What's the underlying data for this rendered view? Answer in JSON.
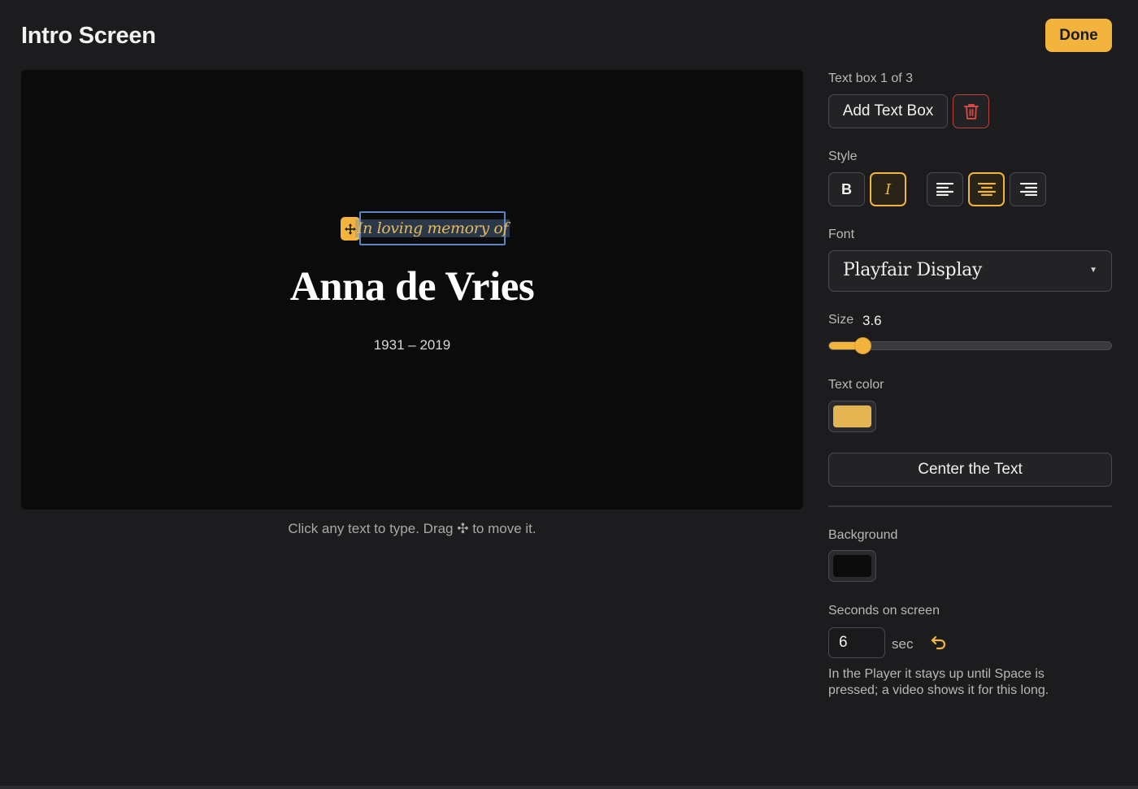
{
  "header": {
    "title": "Intro Screen",
    "done_label": "Done"
  },
  "stage": {
    "subtitle": "In loving memory of",
    "name": "Anna de Vries",
    "dates": "1931 – 2019",
    "hint": "Click any text to type. Drag ✣ to move it."
  },
  "panel": {
    "textbox_counter": "Text box 1 of 3",
    "add_textbox_label": "Add Text Box",
    "style_label": "Style",
    "bold_label": "B",
    "italic_label": "I",
    "font_label": "Font",
    "font_value": "Playfair Display",
    "size_label": "Size",
    "size_value": "3.6",
    "size_fraction": 0.117,
    "text_color_label": "Text color",
    "text_color": "#e3b553",
    "center_text_label": "Center the Text",
    "background_label": "Background",
    "background_color": "#0b0b0c",
    "seconds_label": "Seconds on screen",
    "seconds_value": "6",
    "sec_unit": "sec",
    "note": "In the Player it stays up until Space is pressed; a video shows it for this long."
  },
  "state": {
    "bold": false,
    "italic": true,
    "align": "center"
  },
  "colors": {
    "accent": "#f2b43c",
    "selection_border": "#5b86c6",
    "danger": "#d24a43"
  }
}
